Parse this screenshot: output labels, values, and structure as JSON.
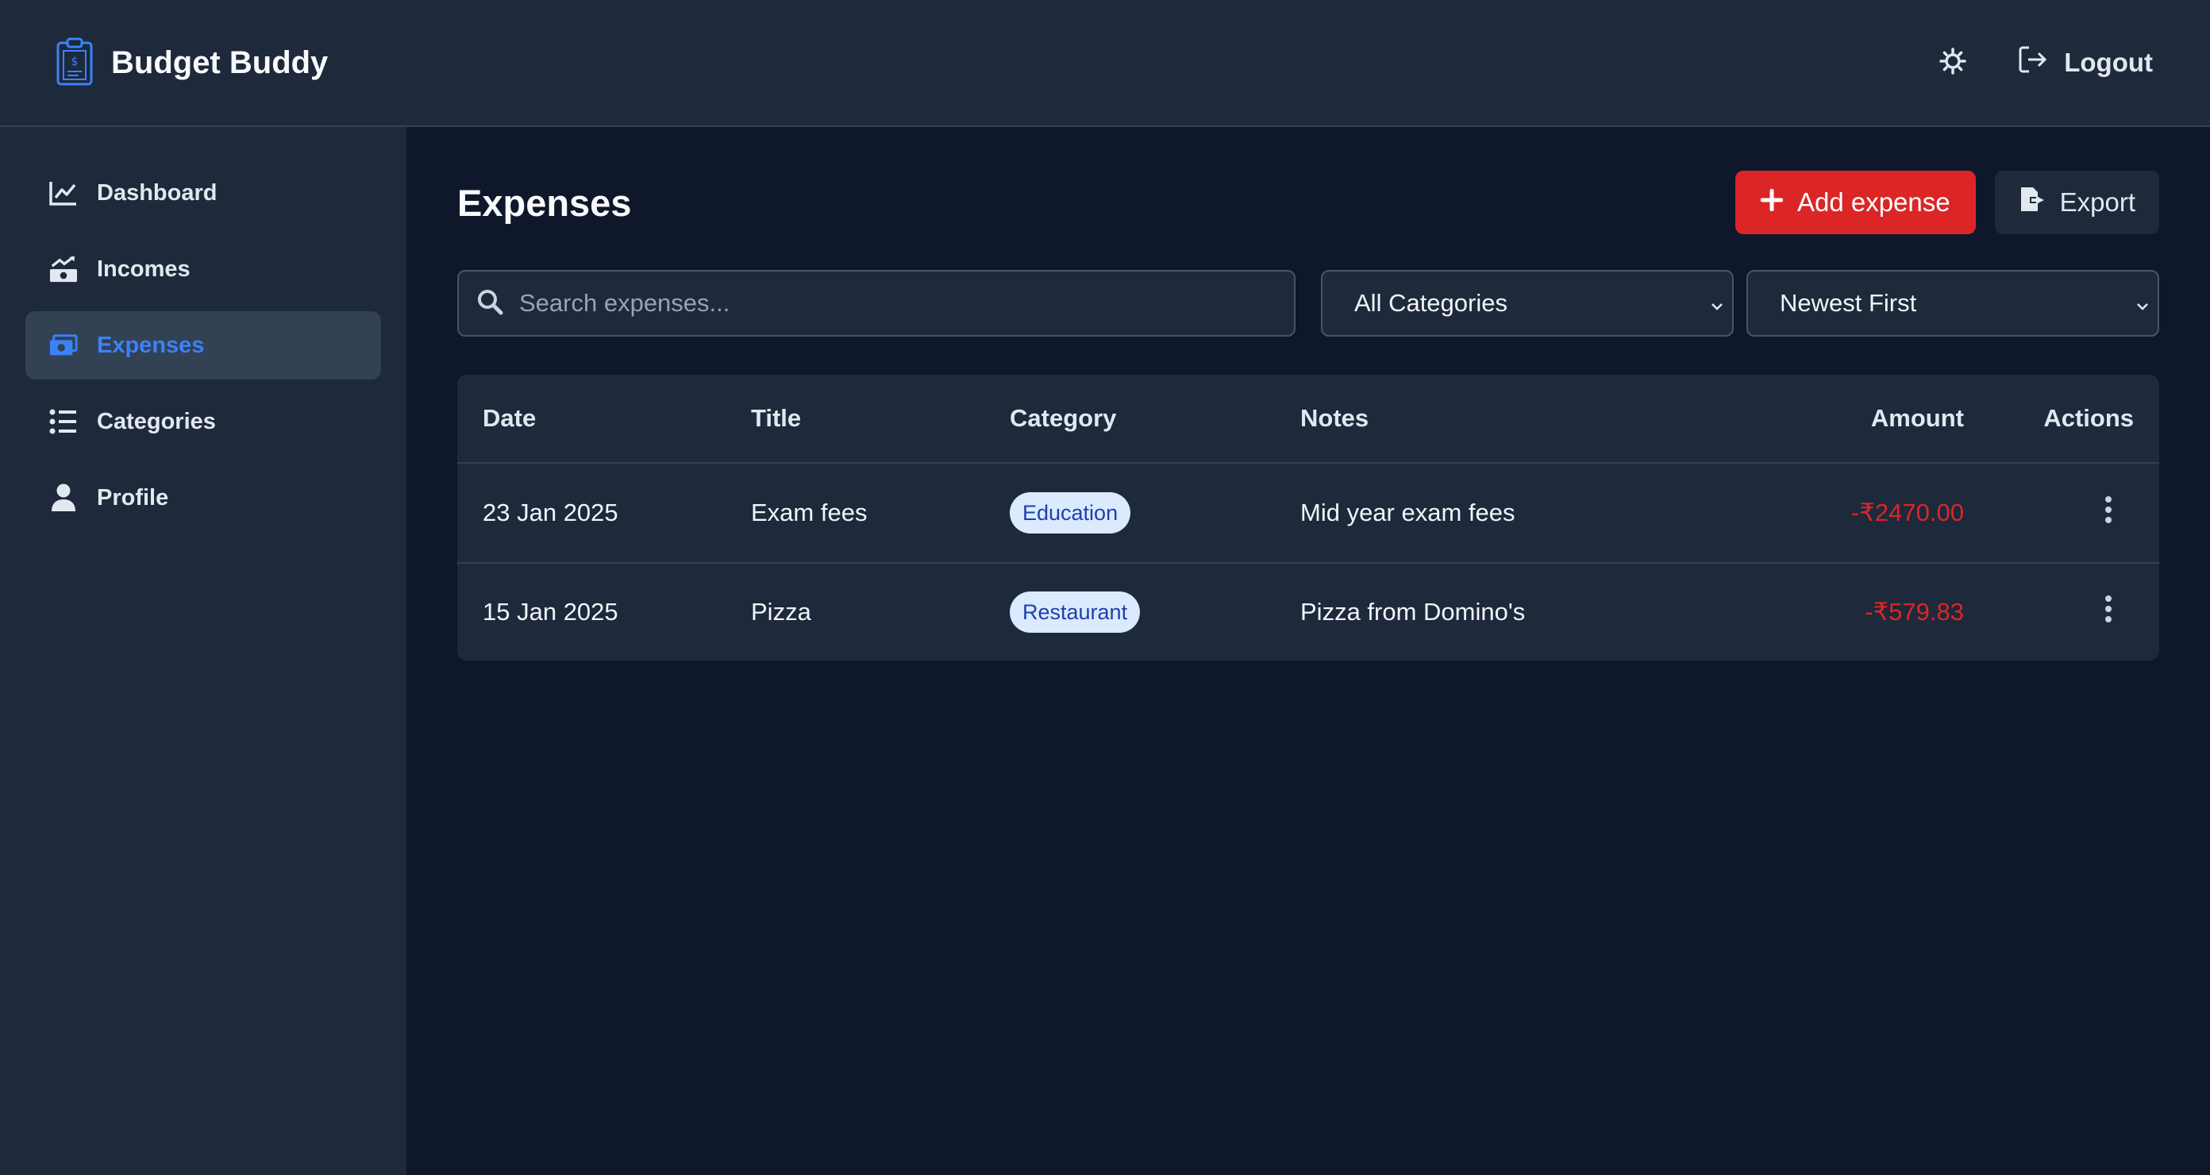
{
  "app": {
    "title": "Budget Buddy"
  },
  "header": {
    "logout_label": "Logout"
  },
  "sidebar": {
    "items": [
      {
        "label": "Dashboard",
        "icon": "chart-line-icon"
      },
      {
        "label": "Incomes",
        "icon": "money-growth-icon"
      },
      {
        "label": "Expenses",
        "icon": "money-bill-icon",
        "active": true
      },
      {
        "label": "Categories",
        "icon": "list-icon"
      },
      {
        "label": "Profile",
        "icon": "user-icon"
      }
    ]
  },
  "main": {
    "title": "Expenses",
    "add_label": "Add expense",
    "export_label": "Export",
    "search_placeholder": "Search expenses...",
    "category_filter": "All Categories",
    "sort_filter": "Newest First"
  },
  "table": {
    "headers": {
      "date": "Date",
      "title": "Title",
      "category": "Category",
      "notes": "Notes",
      "amount": "Amount",
      "actions": "Actions"
    },
    "rows": [
      {
        "date": "23 Jan 2025",
        "title": "Exam fees",
        "category": "Education",
        "notes": "Mid year exam fees",
        "amount": "-₹2470.00"
      },
      {
        "date": "15 Jan 2025",
        "title": "Pizza",
        "category": "Restaurant",
        "notes": "Pizza from Domino's",
        "amount": "-₹579.83"
      }
    ]
  },
  "colors": {
    "accent": "#3b82f6",
    "danger": "#dc2626",
    "bg": "#0f172a",
    "surface": "#1e293b"
  }
}
